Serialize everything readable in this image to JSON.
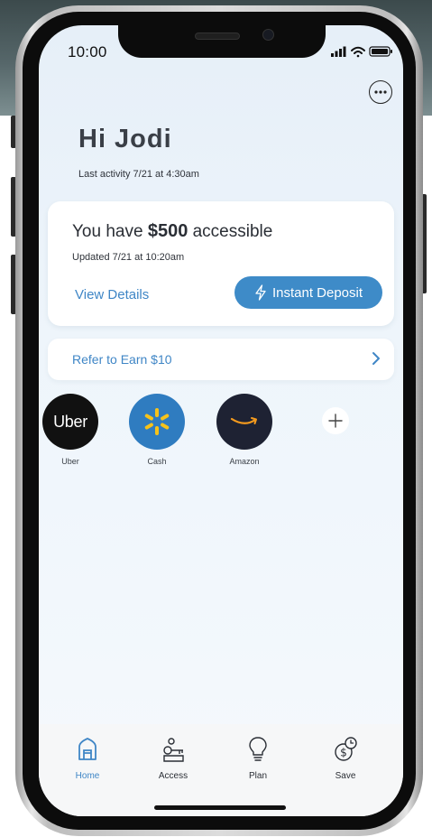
{
  "status_bar": {
    "time": "10:00"
  },
  "header": {
    "greeting": "Hi Jodi",
    "last_activity": "Last activity 7/21 at 4:30am"
  },
  "balance_card": {
    "prefix": "You have",
    "amount": "$500",
    "suffix": "accessible",
    "updated": "Updated 7/21 at 10:20am",
    "details_link": "View Details",
    "deposit_button": "Instant Deposit"
  },
  "refer": {
    "label": "Refer to Earn $10"
  },
  "merchants": [
    {
      "name": "Uber",
      "logo_text": "Uber",
      "color": "#111111",
      "icon": "uber-logo"
    },
    {
      "name": "Cash",
      "color": "#2f7cc0",
      "icon": "walmart-spark-icon"
    },
    {
      "name": "Amazon",
      "color": "#1e2233",
      "icon": "amazon-smile-icon"
    }
  ],
  "tabs": [
    {
      "label": "Home",
      "icon": "home-icon",
      "active": true
    },
    {
      "label": "Access",
      "icon": "key-icon",
      "active": false
    },
    {
      "label": "Plan",
      "icon": "lightbulb-icon",
      "active": false
    },
    {
      "label": "Save",
      "icon": "dollar-clock-icon",
      "active": false
    }
  ],
  "colors": {
    "accent": "#3e8bc8",
    "link": "#3f86c6",
    "text": "#3a3f47"
  }
}
